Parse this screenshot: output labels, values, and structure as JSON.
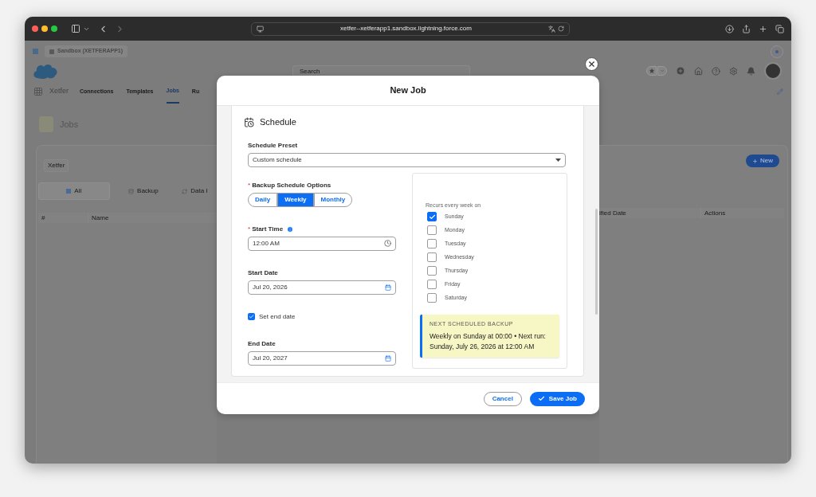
{
  "browser": {
    "url": "xetfer--xetferapp1.sandbox.lightning.force.com"
  },
  "app": {
    "org_chip": "Sandbox (XETFERAPP1)",
    "search": {
      "placeholder": "Search"
    },
    "app_name": "Xetfer",
    "nav": [
      {
        "label": "Connections",
        "selected": false
      },
      {
        "label": "Templates",
        "selected": false
      },
      {
        "label": "Jobs",
        "selected": true
      },
      {
        "label": "Ru",
        "selected": false
      }
    ],
    "page_title": "Jobs",
    "filter_chip": "Xetfer",
    "tabs": [
      {
        "label": "All",
        "selected": true
      },
      {
        "label": "Backup",
        "selected": false
      },
      {
        "label": "Data I",
        "selected": false
      }
    ],
    "new_button": "New",
    "left_columns": [
      "#",
      "Name"
    ],
    "right_columns": [
      "ified Date",
      "Actions"
    ]
  },
  "modal": {
    "title": "New Job",
    "section_title": "Schedule",
    "preset": {
      "label": "Schedule Preset",
      "value": "Custom schedule"
    },
    "options": {
      "label": "Backup Schedule Options",
      "required_mark": "*",
      "choices": [
        {
          "label": "Daily",
          "selected": false
        },
        {
          "label": "Weekly",
          "selected": true
        },
        {
          "label": "Monthly",
          "selected": false
        }
      ]
    },
    "start_time": {
      "label": "Start Time",
      "required_mark": "*",
      "value": "12:00 AM"
    },
    "start_date": {
      "label": "Start Date",
      "value": "Jul 20, 2026"
    },
    "set_end_date": {
      "label": "Set end date",
      "checked": true
    },
    "end_date": {
      "label": "End Date",
      "value": "Jul 20, 2027"
    },
    "recurs": {
      "label": "Recurs every week on",
      "days": [
        {
          "label": "Sunday",
          "checked": true
        },
        {
          "label": "Monday",
          "checked": false
        },
        {
          "label": "Tuesday",
          "checked": false
        },
        {
          "label": "Wednesday",
          "checked": false
        },
        {
          "label": "Thursday",
          "checked": false
        },
        {
          "label": "Friday",
          "checked": false
        },
        {
          "label": "Saturday",
          "checked": false
        }
      ]
    },
    "next_backup": {
      "title": "NEXT SCHEDULED BACKUP",
      "text": "Weekly on Sunday at 00:00 • Next run: Sunday, July 26, 2026 at 12:00 AM"
    },
    "cancel_button": "Cancel",
    "save_button": "Save Job"
  }
}
